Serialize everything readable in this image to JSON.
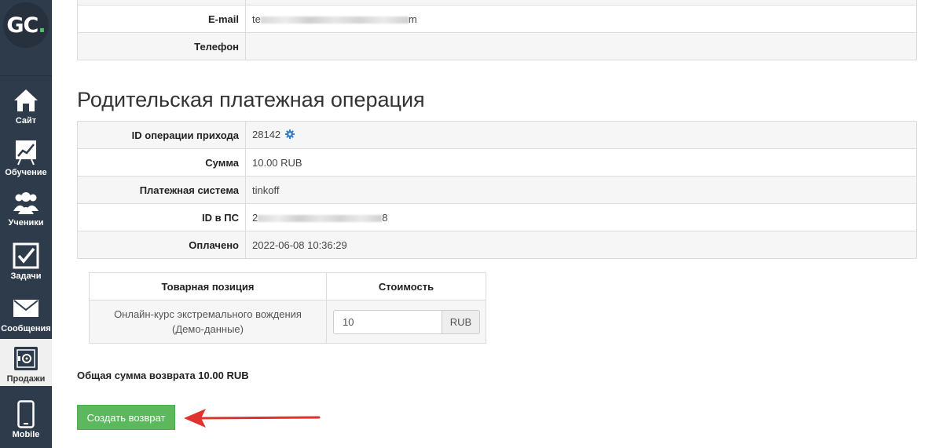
{
  "sidebar": {
    "logo": {
      "text": "GC",
      "dot": "."
    },
    "items": [
      {
        "label": "Сайт",
        "icon": "home-icon"
      },
      {
        "label": "Обучение",
        "icon": "training-chart-icon"
      },
      {
        "label": "Ученики",
        "icon": "users-icon"
      },
      {
        "label": "Задачи",
        "icon": "checkbox-icon"
      },
      {
        "label": "Сообщения",
        "icon": "envelope-icon"
      },
      {
        "label": "Продажи",
        "icon": "safe-icon"
      },
      {
        "label": "Mobile",
        "icon": "phone-icon"
      }
    ],
    "active_index": 5,
    "colors": {
      "background": "#2e3b4a",
      "active": "#f0f0f0",
      "logo_accent": "#4fc16b"
    }
  },
  "contact": {
    "rows": [
      {
        "label": "E-mail",
        "value_start": "te",
        "value_end": "m"
      },
      {
        "label": "Телефон",
        "value": ""
      }
    ]
  },
  "parent_operation": {
    "title": "Родительская платежная операция",
    "rows": [
      {
        "label": "ID операции прихода",
        "value": "28142"
      },
      {
        "label": "Сумма",
        "value": "10.00 RUB"
      },
      {
        "label": "Платежная система",
        "value": "tinkoff"
      },
      {
        "label": "ID в ПС",
        "value_start": "2",
        "value_end": "8"
      },
      {
        "label": "Оплачено",
        "value": "2022-06-08 10:36:29"
      }
    ]
  },
  "items_table": {
    "headers": [
      "Товарная позиция",
      "Стоимость"
    ],
    "rows": [
      {
        "name": "Онлайн-курс экстремального вождения (Демо-данные)",
        "price": "10",
        "currency": "RUB"
      }
    ]
  },
  "total": {
    "text": "Общая сумма возврата 10.00 RUB"
  },
  "actions": {
    "create_refund_label": "Создать возврат",
    "color": "#5cb85c"
  },
  "annotation": {
    "arrow_color": "#e0322f"
  }
}
